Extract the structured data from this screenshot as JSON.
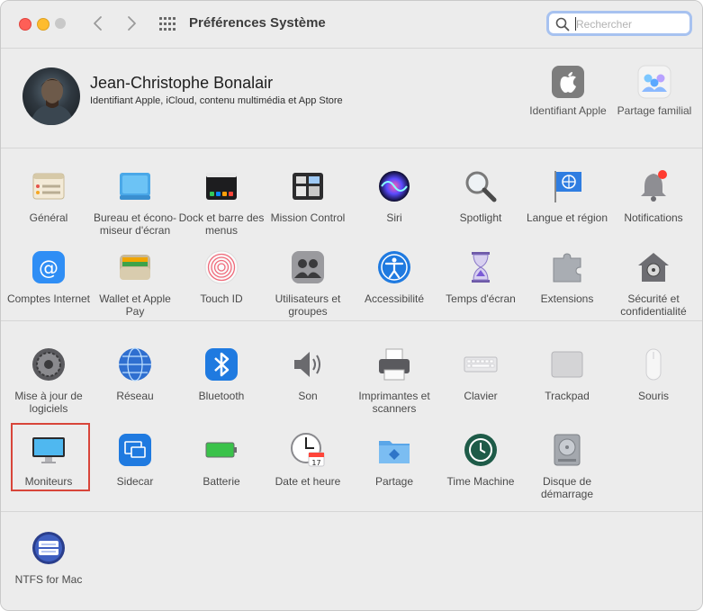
{
  "window": {
    "title": "Préférences Système",
    "search_placeholder": "Rechercher"
  },
  "account": {
    "name": "Jean-Christophe Bonalair",
    "subtitle": "Identifiant Apple, iCloud, contenu multimédia et App Store",
    "items": [
      {
        "label": "Identifiant Apple",
        "icon": "apple-id-icon"
      },
      {
        "label": "Partage familial",
        "icon": "family-sharing-icon"
      }
    ]
  },
  "section1": [
    {
      "label": "Général",
      "icon": "general-icon"
    },
    {
      "label": "Bureau et écono-miseur d'écran",
      "icon": "desktop-screensaver-icon"
    },
    {
      "label": "Dock et barre des menus",
      "icon": "dock-menubar-icon"
    },
    {
      "label": "Mission Control",
      "icon": "mission-control-icon"
    },
    {
      "label": "Siri",
      "icon": "siri-icon"
    },
    {
      "label": "Spotlight",
      "icon": "spotlight-icon"
    },
    {
      "label": "Langue et région",
      "icon": "language-region-icon"
    },
    {
      "label": "Notifications",
      "icon": "notifications-icon"
    },
    {
      "label": "Comptes Internet",
      "icon": "internet-accounts-icon"
    },
    {
      "label": "Wallet et Apple Pay",
      "icon": "wallet-icon"
    },
    {
      "label": "Touch ID",
      "icon": "touch-id-icon"
    },
    {
      "label": "Utilisateurs et groupes",
      "icon": "users-groups-icon"
    },
    {
      "label": "Accessibilité",
      "icon": "accessibility-icon"
    },
    {
      "label": "Temps d'écran",
      "icon": "screen-time-icon"
    },
    {
      "label": "Extensions",
      "icon": "extensions-icon"
    },
    {
      "label": "Sécurité et confidentialité",
      "icon": "security-icon"
    }
  ],
  "section2": [
    {
      "label": "Mise à jour de logiciels",
      "icon": "software-update-icon"
    },
    {
      "label": "Réseau",
      "icon": "network-icon"
    },
    {
      "label": "Bluetooth",
      "icon": "bluetooth-icon"
    },
    {
      "label": "Son",
      "icon": "sound-icon"
    },
    {
      "label": "Imprimantes et scanners",
      "icon": "printers-icon"
    },
    {
      "label": "Clavier",
      "icon": "keyboard-icon"
    },
    {
      "label": "Trackpad",
      "icon": "trackpad-icon"
    },
    {
      "label": "Souris",
      "icon": "mouse-icon"
    },
    {
      "label": "Moniteurs",
      "icon": "displays-icon"
    },
    {
      "label": "Sidecar",
      "icon": "sidecar-icon"
    },
    {
      "label": "Batterie",
      "icon": "battery-icon"
    },
    {
      "label": "Date et heure",
      "icon": "date-time-icon"
    },
    {
      "label": "Partage",
      "icon": "sharing-icon"
    },
    {
      "label": "Time Machine",
      "icon": "time-machine-icon"
    },
    {
      "label": "Disque de démarrage",
      "icon": "startup-disk-icon"
    }
  ],
  "section3": [
    {
      "label": "NTFS for Mac",
      "icon": "ntfs-for-mac-icon"
    }
  ],
  "date_icon_day": "17",
  "colors": {
    "highlight": "#d8453a",
    "search_focus": "#a7c2f0"
  }
}
